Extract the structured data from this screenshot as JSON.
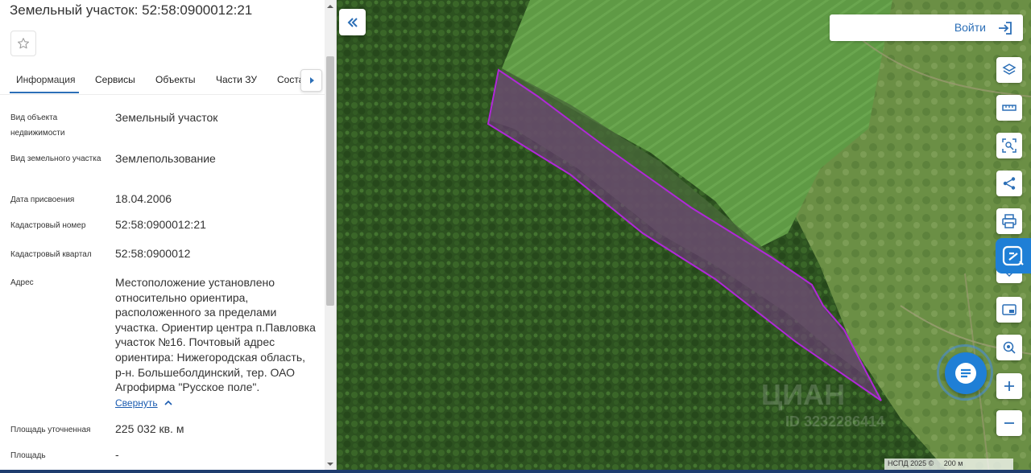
{
  "panel": {
    "title": "Земельный участок: 52:58:0900012:21",
    "tabs": [
      "Информация",
      "Сервисы",
      "Объекты",
      "Части ЗУ",
      "Состав"
    ],
    "rows": [
      {
        "label": "Вид объекта недвижимости",
        "value": "Земельный участок"
      },
      {
        "label": "Вид земельного участка",
        "value": "Землепользование"
      },
      {
        "label": "Дата присвоения",
        "value": "18.04.2006"
      },
      {
        "label": "Кадастровый номер",
        "value": "52:58:0900012:21"
      },
      {
        "label": "Кадастровый квартал",
        "value": "52:58:0900012"
      },
      {
        "label": "Адрес",
        "value": "Местоположение установлено относительно ориентира, расположенного за пределами участка. Ориентир центра п.Павловка участок №16. Почтовый адрес ориентира: Нижегородская область, р-н. Большеболдинский, тер. ОАО Агрофирма \"Русское поле\"."
      },
      {
        "label": "Площадь уточненная",
        "value": "225 032 кв. м"
      },
      {
        "label": "Площадь",
        "value": "-"
      }
    ],
    "collapse_link": "Свернуть"
  },
  "map": {
    "login_label": "Войти",
    "watermark": "ЦИАН",
    "watermark_id": "ID 3232286414",
    "attribution": "НСПД 2025 ©",
    "scale_label": "200 м",
    "parcel_color": "#9b1fc4",
    "tools": [
      "layers-icon",
      "ruler-icon",
      "select-area-icon",
      "share-icon",
      "print-icon",
      "minimap-icon",
      "geolocate-icon",
      "zoom-in-icon",
      "zoom-out-icon"
    ]
  },
  "colors": {
    "accent": "#2c6fb7",
    "link": "#1a5bb0",
    "ai_button": "#1f7fd6"
  }
}
